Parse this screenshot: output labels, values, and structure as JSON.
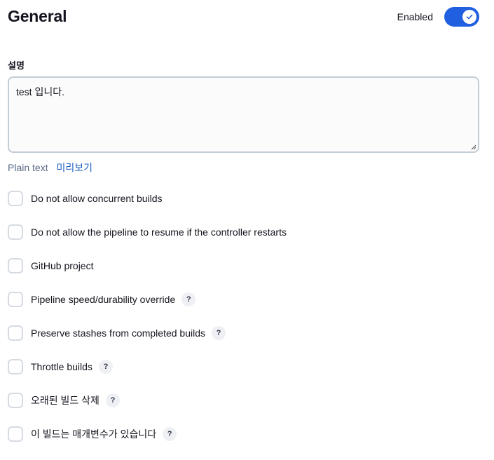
{
  "header": {
    "title": "General",
    "enabled_label": "Enabled",
    "enabled": true
  },
  "description": {
    "label": "설명",
    "value": "test 입니다.",
    "format_label": "Plain text",
    "preview_label": "미리보기"
  },
  "options": [
    {
      "label": "Do not allow concurrent builds",
      "checked": false,
      "help": ""
    },
    {
      "label": "Do not allow the pipeline to resume if the controller restarts",
      "checked": false,
      "help": ""
    },
    {
      "label": "GitHub project",
      "checked": false,
      "help": ""
    },
    {
      "label": "Pipeline speed/durability override",
      "checked": false,
      "help": "?"
    },
    {
      "label": "Preserve stashes from completed builds",
      "checked": false,
      "help": "?"
    },
    {
      "label": "Throttle builds",
      "checked": false,
      "help": "?"
    },
    {
      "label": "오래된 빌드 삭제",
      "checked": false,
      "help": "?"
    },
    {
      "label": "이 빌드는 매개변수가 있습니다",
      "checked": false,
      "help": "?"
    }
  ],
  "colors": {
    "accent": "#2060e0",
    "link": "#1d5fc2",
    "checkbox_border": "#d6dbe2"
  }
}
